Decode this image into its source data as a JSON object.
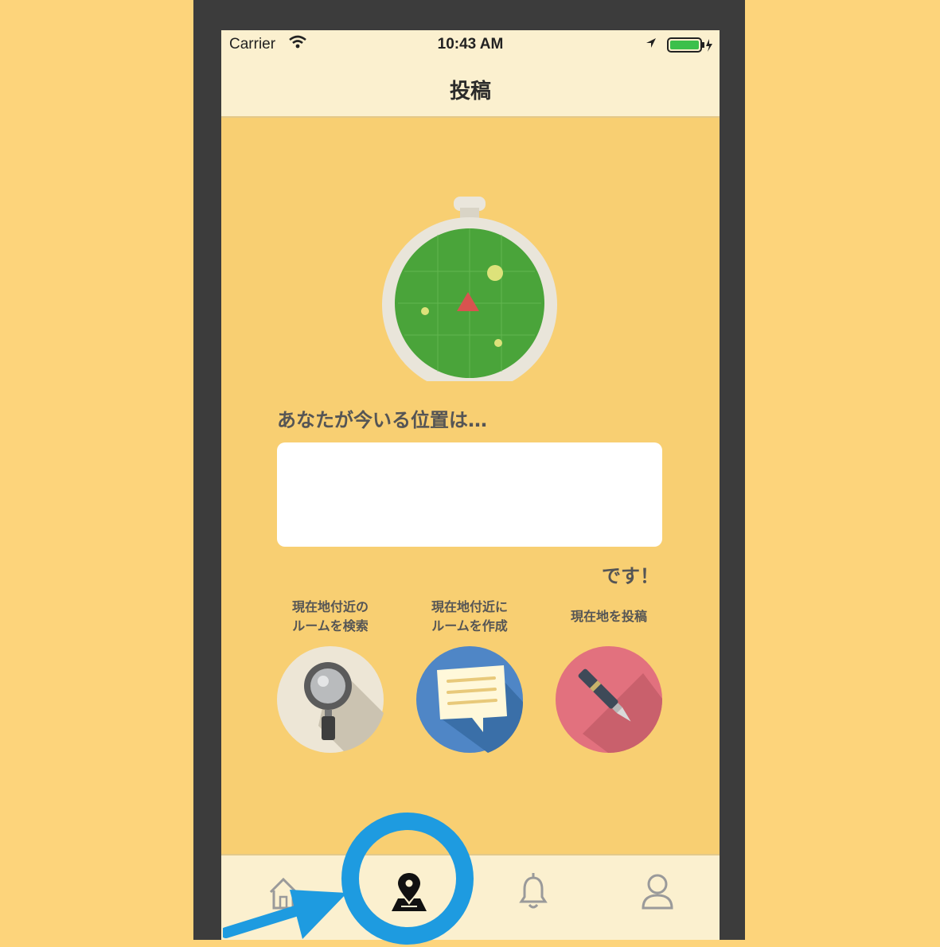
{
  "status_bar": {
    "carrier": "Carrier",
    "time": "10:43 AM"
  },
  "nav": {
    "title": "投稿"
  },
  "main": {
    "prompt": "あなたが今いる位置は…",
    "location_value": "",
    "suffix": "です！"
  },
  "actions": [
    {
      "label_line1": "現在地付近の",
      "label_line2": "ルームを検索",
      "icon": "magnifier-icon",
      "color": "#EDE6D6"
    },
    {
      "label_line1": "現在地付近に",
      "label_line2": "ルームを作成",
      "icon": "chat-bubble-icon",
      "color": "#4F86C6"
    },
    {
      "label_line1": "現在地を投稿",
      "label_line2": "",
      "icon": "pen-icon",
      "color": "#E2717E"
    }
  ],
  "tabs": [
    {
      "name": "home",
      "icon": "home-icon"
    },
    {
      "name": "post",
      "icon": "map-pin-icon",
      "selected": true
    },
    {
      "name": "notifications",
      "icon": "bell-icon"
    },
    {
      "name": "profile",
      "icon": "user-icon"
    }
  ],
  "colors": {
    "background": "#FDD47B",
    "screen": "#F8CF72",
    "bar": "#FBF0CF",
    "highlight": "#1E9BE0"
  }
}
